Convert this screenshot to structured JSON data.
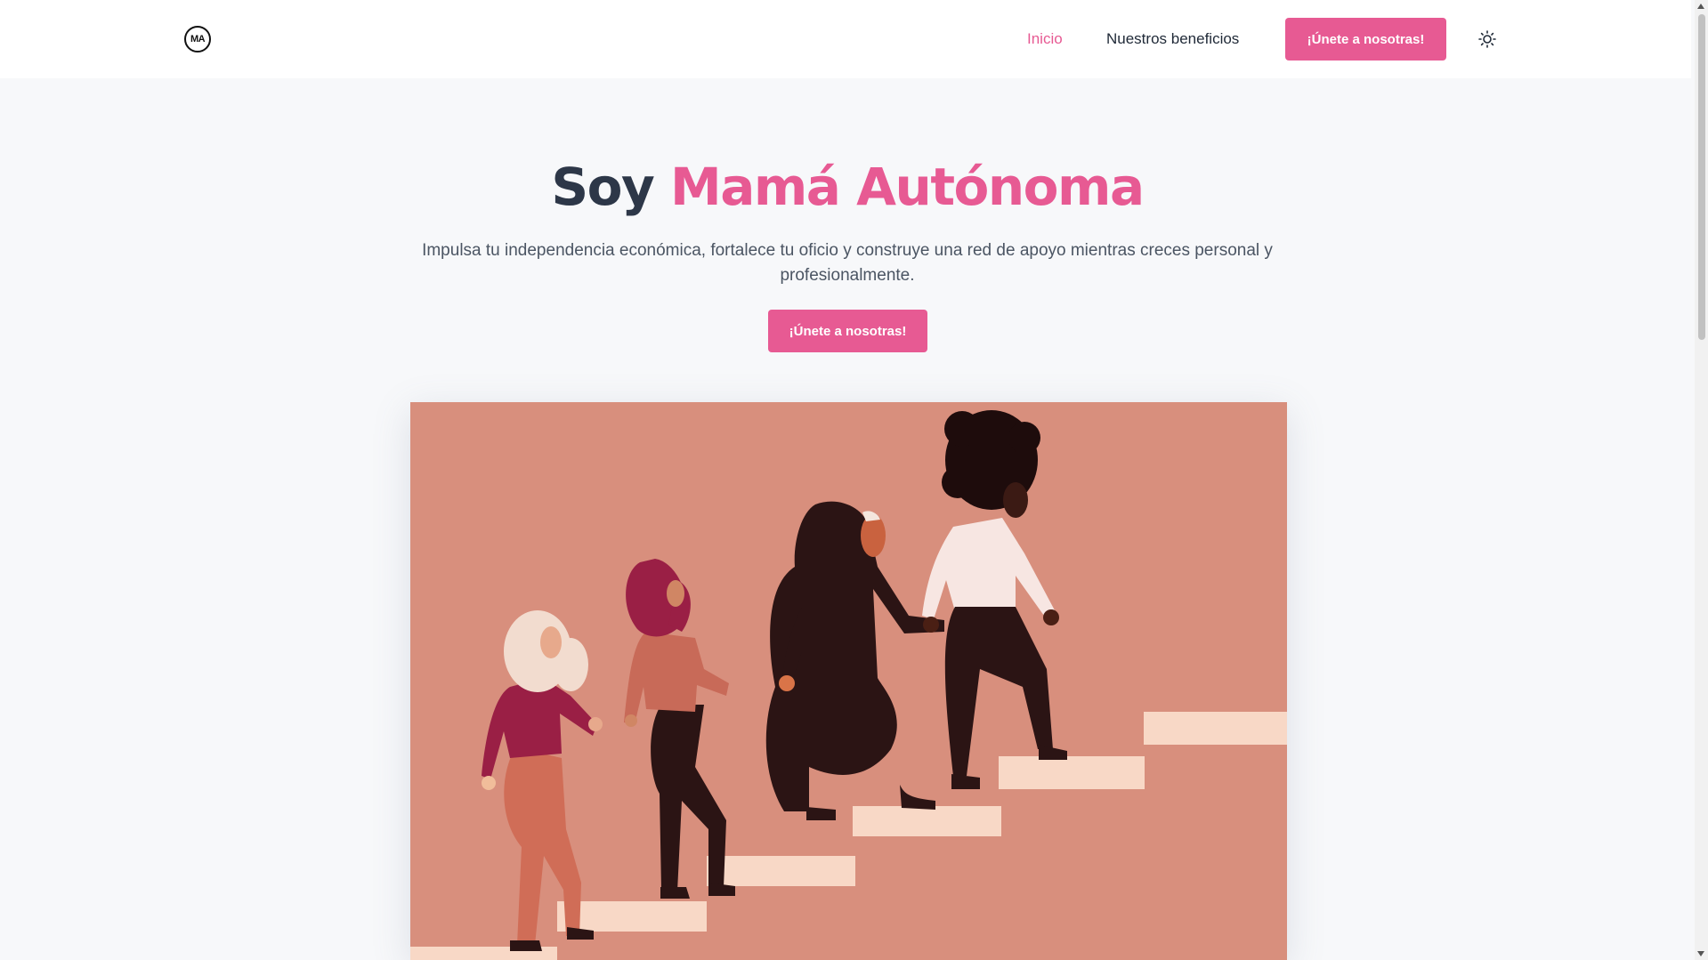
{
  "nav": {
    "logo_text": "MA",
    "links": [
      {
        "label": "Inicio",
        "active": true
      },
      {
        "label": "Nuestros beneficios",
        "active": false
      }
    ],
    "cta_label": "¡Únete a nosotras!",
    "theme_icon": "sun-icon"
  },
  "hero": {
    "title_prefix": "Soy",
    "title_accent": "Mamá Autónoma",
    "subtitle": "Impulsa tu independencia económica, fortalece tu oficio y construye una red de apoyo mientras creces personal y profesionalmente.",
    "cta_label": "¡Únete a nosotras!"
  },
  "colors": {
    "accent": "#e75a93",
    "title": "#2d3748",
    "illustration_bg": "#d88f7d",
    "steps": "#f8d8c6"
  }
}
